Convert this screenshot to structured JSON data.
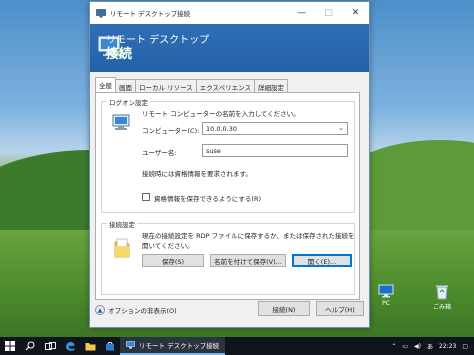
{
  "window": {
    "title": "リモート デスクトップ接続",
    "banner_line1": "リモート デスクトップ",
    "banner_line2": "接続",
    "minimize_icon": "—",
    "maximize_icon": "□",
    "close_icon": "✕"
  },
  "tabs": [
    {
      "label": "全般",
      "active": true
    },
    {
      "label": "画面",
      "active": false
    },
    {
      "label": "ローカル リソース",
      "active": false
    },
    {
      "label": "エクスペリエンス",
      "active": false
    },
    {
      "label": "詳細設定",
      "active": false
    }
  ],
  "logon": {
    "group_label": "ログオン設定",
    "instruction": "リモート コンピューターの名前を入力してください。",
    "computer_label": "コンピューター(C):",
    "computer_value": "10.0.0.30",
    "user_label": "ユーザー名:",
    "user_value": "suse",
    "credential_note": "接続時には資格情報を要求されます。",
    "save_cred_label": "資格情報を保存できるようにする(R)",
    "save_cred_checked": false
  },
  "connection": {
    "group_label": "接続設定",
    "description_line1": "現在の接続設定を RDP ファイルに保存するか、または保存された接続を",
    "description_line2": "開いてください。",
    "save_button": "保存(S)",
    "save_as_button": "名前を付けて保存(V)...",
    "open_button": "開く(E)..."
  },
  "footer": {
    "options_label": "オプションの非表示(O)",
    "connect_button": "接続(N)",
    "help_button": "ヘルプ(H)"
  },
  "desktop": {
    "icons": [
      {
        "label": "PC"
      },
      {
        "label": "ごみ箱"
      }
    ]
  },
  "taskbar": {
    "app_label": "リモート デスクトップ接続",
    "time": "22:23"
  },
  "colors": {
    "banner": "#2462a8",
    "taskbar": "#10141c",
    "focus": "#0078d7"
  }
}
